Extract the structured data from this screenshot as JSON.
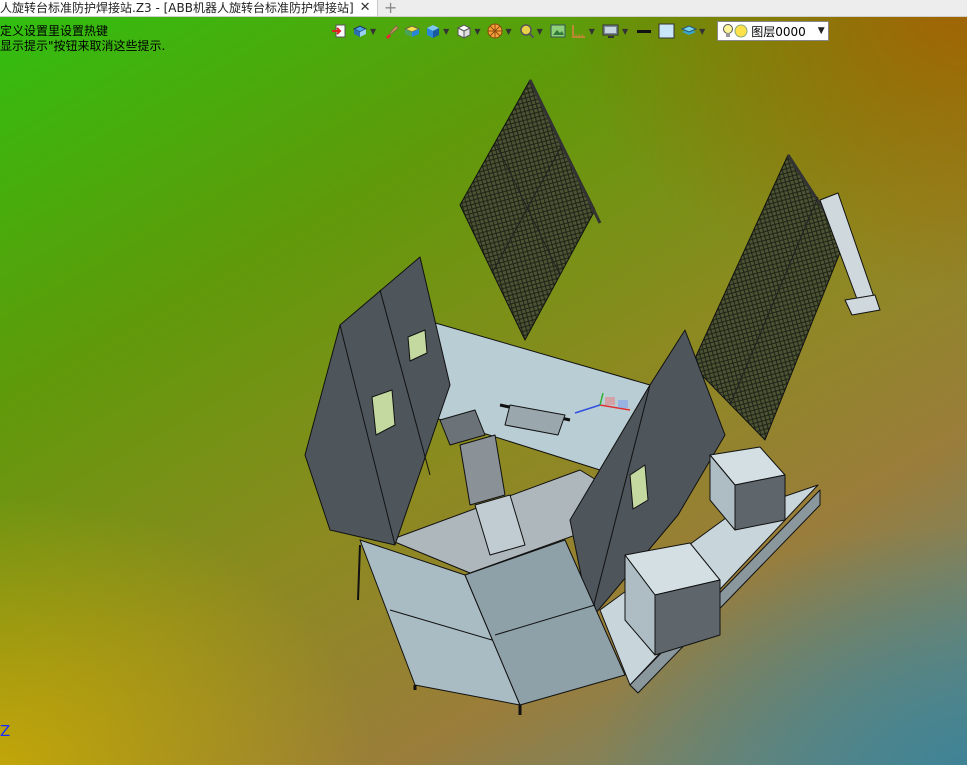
{
  "tabs": [
    {
      "title": "人旋转台标准防护焊接站.Z3 - [ABB机器人旋转台标准防护焊接站]",
      "close": "✕"
    }
  ],
  "tab_add": "+",
  "hints": {
    "line1": "定义设置里设置热键",
    "line2": "显示提示\"按钮来取消这些提示."
  },
  "toolbar": {
    "items": [
      "exit-icon",
      "view-orient-icon",
      "brush-icon",
      "box-shade-icon",
      "cube-blue-icon",
      "cube-white-icon",
      "wheel-icon",
      "zoom-icon",
      "image-icon",
      "ruler-icon",
      "monitor-icon",
      "line-style-icon",
      "color-swatch-icon",
      "layers-icon"
    ],
    "accent": "#2a86d8"
  },
  "layer_selector": {
    "name": "图层0000",
    "bulb_color": "#ffe14a"
  },
  "axis_label": "Z",
  "colors": {
    "panel": "#4e555b",
    "panel_light": "#b9cdd4",
    "mesh": "#3a4034"
  }
}
